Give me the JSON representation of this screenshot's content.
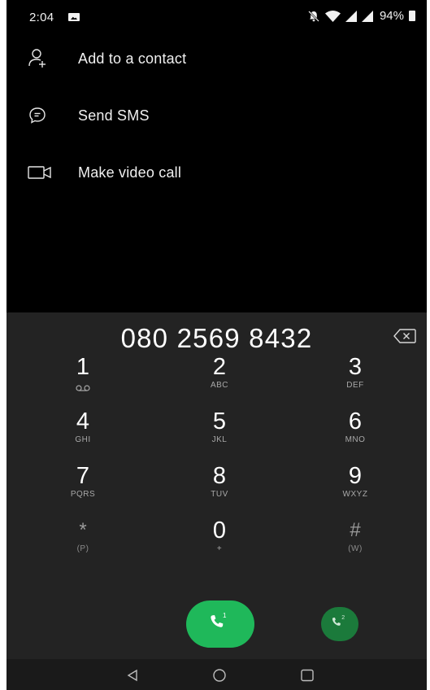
{
  "status_bar": {
    "time": "2:04",
    "battery_percent": "94%",
    "icons": [
      "image-notification-icon",
      "notifications-off-icon",
      "wifi-icon",
      "signal-icon",
      "signal-icon",
      "battery-icon"
    ]
  },
  "options": [
    {
      "icon": "add-contact-icon",
      "label": "Add to a contact"
    },
    {
      "icon": "sms-icon",
      "label": "Send SMS"
    },
    {
      "icon": "video-call-icon",
      "label": "Make video call"
    }
  ],
  "dialer": {
    "number": "080 2569 8432",
    "backspace_icon": "backspace-icon",
    "keys": [
      {
        "digit": "1",
        "letters": "",
        "icon": "voicemail-icon"
      },
      {
        "digit": "2",
        "letters": "ABC"
      },
      {
        "digit": "3",
        "letters": "DEF"
      },
      {
        "digit": "4",
        "letters": "GHI"
      },
      {
        "digit": "5",
        "letters": "JKL"
      },
      {
        "digit": "6",
        "letters": "MNO"
      },
      {
        "digit": "7",
        "letters": "PQRS"
      },
      {
        "digit": "8",
        "letters": "TUV"
      },
      {
        "digit": "9",
        "letters": "WXYZ"
      },
      {
        "digit": "*",
        "letters": "(P)"
      },
      {
        "digit": "0",
        "letters": "+"
      },
      {
        "digit": "#",
        "letters": "(W)"
      }
    ],
    "call_sim1": {
      "icon": "phone-icon",
      "sim": "1"
    },
    "call_sim2": {
      "icon": "phone-icon",
      "sim": "2"
    },
    "colors": {
      "panel": "#232323",
      "call_primary": "#1fb85a",
      "call_secondary": "#1b7a3b"
    }
  },
  "nav_bar": {
    "icons": [
      "back-icon",
      "home-icon",
      "recents-icon"
    ]
  }
}
